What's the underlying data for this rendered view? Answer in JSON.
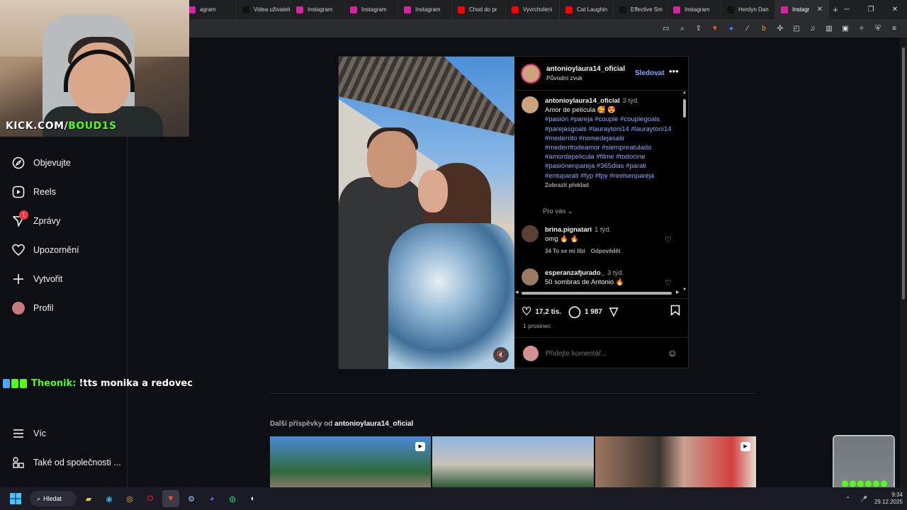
{
  "browser": {
    "tabs": [
      {
        "label": "agram",
        "icon_color": "#d6249f"
      },
      {
        "label": "Videa uživatelů",
        "icon_color": "#111111"
      },
      {
        "label": "Instagram",
        "icon_color": "#d6249f"
      },
      {
        "label": "Instagram",
        "icon_color": "#d6249f"
      },
      {
        "label": "Instagram",
        "icon_color": "#d6249f"
      },
      {
        "label": "Chod do pr",
        "icon_color": "#ff0000"
      },
      {
        "label": "Vyvrcholení",
        "icon_color": "#ff0000"
      },
      {
        "label": "Cat Laughin",
        "icon_color": "#ff0000"
      },
      {
        "label": "Effective Sm",
        "icon_color": "#111111"
      },
      {
        "label": "Instagram",
        "icon_color": "#d6249f"
      },
      {
        "label": "Herdyn Dan",
        "icon_color": "#111111"
      },
      {
        "label": "Instagr",
        "icon_color": "#d6249f"
      }
    ],
    "new_tab": "+",
    "address_fragment": "/"
  },
  "webcam": {
    "overlay_prefix": "KICK.COM/",
    "overlay_name": "BOUD1S"
  },
  "chat": {
    "user": "Theonik:",
    "message": "!tts monika a redovec"
  },
  "sidebar": {
    "items": [
      {
        "label": "Objevujte",
        "icon": "compass-icon"
      },
      {
        "label": "Reels",
        "icon": "reels-icon"
      },
      {
        "label": "Zprávy",
        "icon": "messenger-icon",
        "badge": "1"
      },
      {
        "label": "Upozornění",
        "icon": "heart-icon"
      },
      {
        "label": "Vytvořit",
        "icon": "plus-icon"
      },
      {
        "label": "Profil",
        "icon": "avatar"
      }
    ],
    "bottom": [
      {
        "label": "Víc",
        "icon": "menu-icon"
      },
      {
        "label": "Také od společnosti ...",
        "icon": "apps-icon"
      }
    ]
  },
  "post": {
    "username": "antonioylaura14_oficial",
    "audio": "Původní zvuk",
    "follow": "Sledovat",
    "caption": {
      "username": "antonioylaura14_oficial",
      "time": "3 týd.",
      "text": "Amor de película 🥰 😍",
      "hashtags": "#pasión #pareja #couple #couplegoals #parejasgoals #lauraytoni14 #lauraytoni14 #mederrito #nomedejasalir #mederritodeamor #siempreatulado #amordepelicula #filme #todocine #pasiónenpareja #365dias #parati #entuparati #fyp #fpy #reelsenpareja",
      "translate": "Zobrazit překlad"
    },
    "for_you": "Pro vás",
    "comments": [
      {
        "username": "brina.pignatari",
        "time": "1 týd.",
        "text": "omg 🔥 🔥",
        "likes": "34 To se mi líbí",
        "reply": "Odpovědět"
      },
      {
        "username": "esperanzafjurado_",
        "time": "3 týd.",
        "text": "50 sombras de Antonio 🔥"
      }
    ],
    "likes": "17,2 tis.",
    "comment_count": "1 987",
    "date": "1 prosinec",
    "add_comment_placeholder": "Přidejte komentář..."
  },
  "more_posts": {
    "prefix": "Další příspěvky od",
    "username": "antonioylaura14_oficial"
  },
  "taskbar": {
    "search": "Hledat",
    "time": "9:34",
    "date": "29.12.2025"
  }
}
